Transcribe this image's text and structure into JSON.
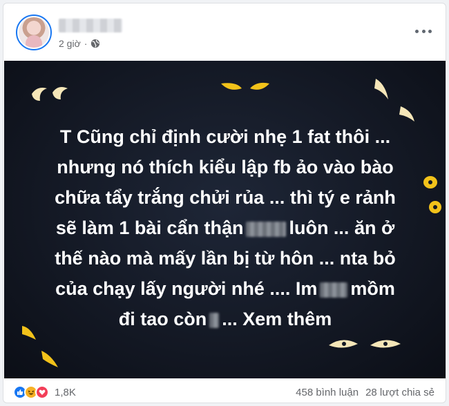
{
  "post": {
    "time": "2 giờ",
    "privacy_icon": "globe-icon",
    "more_icon": "more-options-icon"
  },
  "image_text": {
    "line1": "T Cũng chỉ định cười nhẹ 1 fat thôi ...",
    "line2": "nhưng nó thích kiểu lập fb ảo vào bào",
    "line3": "chữa tẩy trắng chửi rủa ... thì tý e rảnh",
    "line4_before": "sẽ làm 1 bài cẩn thận",
    "line4_after": "luôn ... ăn ở",
    "line5": "thế nào mà mấy lần bị từ hôn ... nta bỏ",
    "line6": "của chạy lấy người nhé .... Im",
    "line6_after": "mồm",
    "line7_before": "đi tao còn",
    "line7_after": "... Xem thêm"
  },
  "footer": {
    "reaction_icons": [
      "like-icon",
      "haha-icon",
      "love-icon"
    ],
    "reaction_count": "1,8K",
    "comments": "458 bình luận",
    "shares": "28 lượt chia sẻ"
  },
  "colors": {
    "accent": "#1877f2",
    "background": "#141925",
    "eyes": "#f5e6b8",
    "eyes_yellow": "#f2c21a"
  }
}
